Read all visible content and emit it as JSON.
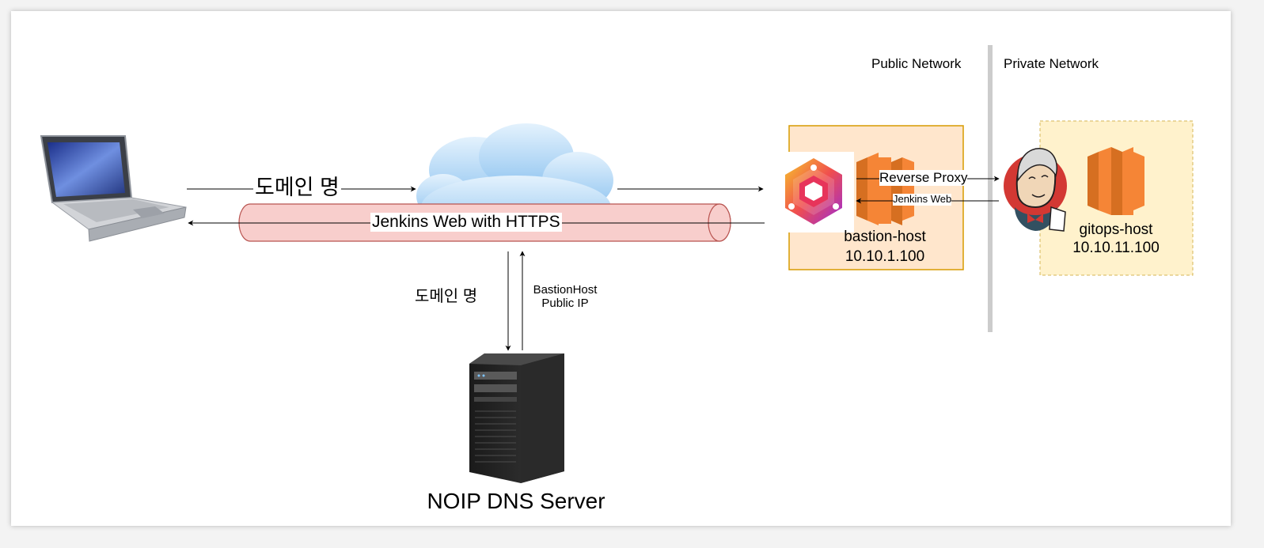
{
  "network": {
    "public_label": "Public Network",
    "private_label": "Private Network"
  },
  "client": {
    "domain_label": "도메인 명",
    "tunnel_label": "Jenkins Web with HTTPS"
  },
  "dns": {
    "query_label": "도메인 명",
    "response_label_line1": "BastionHost",
    "response_label_line2": "Public IP",
    "server_label": "NOIP DNS Server"
  },
  "bastion": {
    "name": "bastion-host",
    "ip": "10.10.1.100",
    "proxy_label": "Reverse Proxy",
    "jenkins_web_label": "Jenkins Web"
  },
  "gitops": {
    "name": "gitops-host",
    "ip": "10.10.11.100"
  },
  "colors": {
    "bastion_fill": "#ffe6cc",
    "bastion_stroke": "#d79b00",
    "gitops_fill": "#fff2cc",
    "gitops_stroke": "#d6b656",
    "tunnel_fill": "#f8cecc",
    "tunnel_stroke": "#b85450",
    "aws_orange": "#f58536",
    "cloud_blue": "#b9dcf7",
    "divider": "#cccccc"
  }
}
